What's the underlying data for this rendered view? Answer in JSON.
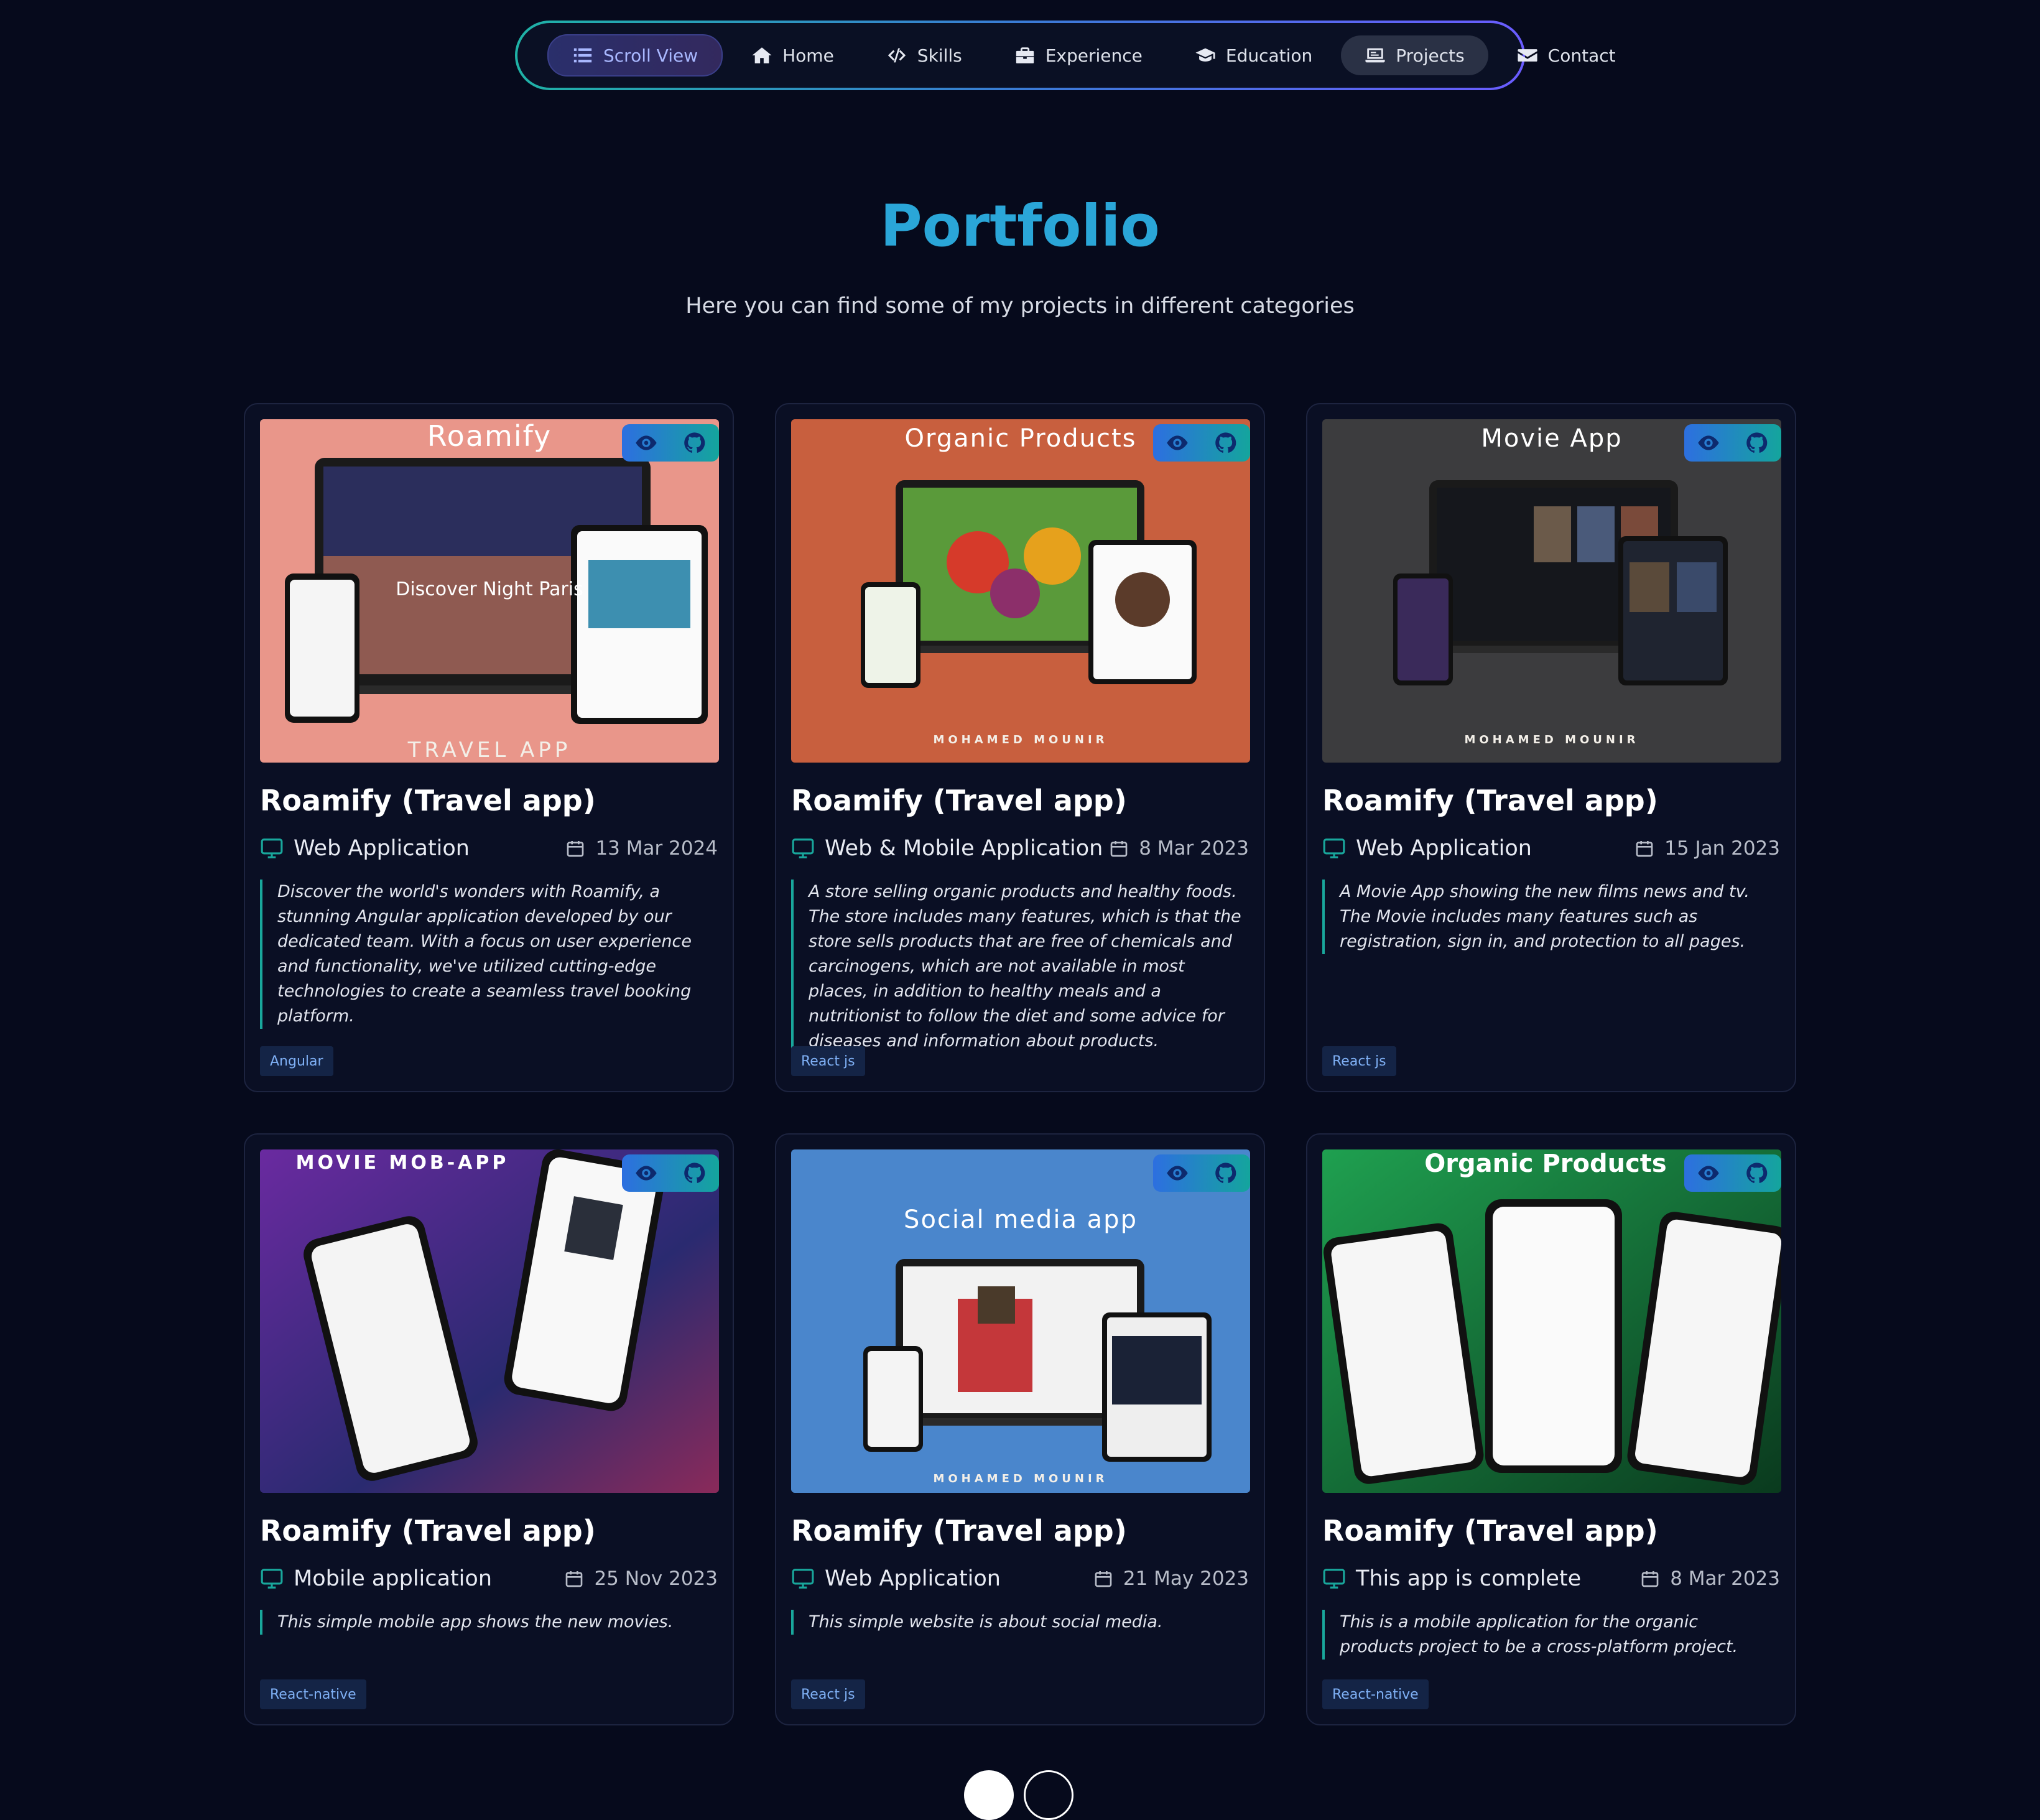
{
  "nav": {
    "items": [
      {
        "label": "Scroll View",
        "icon": "list-icon"
      },
      {
        "label": "Home",
        "icon": "home-icon"
      },
      {
        "label": "Skills",
        "icon": "code-icon"
      },
      {
        "label": "Experience",
        "icon": "briefcase-icon"
      },
      {
        "label": "Education",
        "icon": "graduation-cap-icon"
      },
      {
        "label": "Projects",
        "icon": "laptop-icon",
        "active": true
      },
      {
        "label": "Contact",
        "icon": "envelope-icon"
      }
    ]
  },
  "header": {
    "title": "Portfolio",
    "subtitle": "Here you can find some of my projects in different categories"
  },
  "projects": [
    {
      "thumb_caption": "Roamify",
      "thumb_footer": "TRAVEL APP",
      "thumb_tagline": "Discover Night Paris",
      "thumb_bg": "#e9968a",
      "title": "Roamify (Travel app)",
      "category": "Web Application",
      "date": "13 Mar 2024",
      "description": "Discover the world's wonders with Roamify, a stunning Angular application developed by our dedicated team. With a focus on user experience and functionality, we've utilized cutting-edge technologies to create a seamless travel booking platform.",
      "tag": "Angular"
    },
    {
      "thumb_caption": "Organic Products",
      "thumb_footer": "MOHAMED MOUNIR",
      "thumb_bg": "#c85f3e",
      "title": "Roamify (Travel app)",
      "category": "Web & Mobile Application",
      "date": "8 Mar 2023",
      "description": "A store selling organic products and healthy foods. The store includes many features, which is that the store sells products that are free of chemicals and carcinogens, which are not available in most places, in addition to healthy meals and a nutritionist to follow the diet and some advice for diseases and information about products.",
      "tag": "React js"
    },
    {
      "thumb_caption": "Movie App",
      "thumb_footer": "MOHAMED MOUNIR",
      "thumb_bg": "#3c3c3e",
      "title": "Roamify (Travel app)",
      "category": "Web Application",
      "date": "15 Jan 2023",
      "description": "A Movie App showing the new films news and tv. The Movie includes many features such as registration, sign in, and protection to all pages.",
      "tag": "React js"
    },
    {
      "thumb_caption": "MOVIE MOB-APP",
      "thumb_footer": "",
      "thumb_bg": "#5a2a8a",
      "title": "Roamify (Travel app)",
      "category": "Mobile application",
      "date": "25 Nov 2023",
      "description": "This simple mobile app shows the new movies.",
      "tag": "React-native"
    },
    {
      "thumb_caption": "Social media app",
      "thumb_footer": "MOHAMED MOUNIR",
      "thumb_bg": "#4a86cc",
      "title": "Roamify (Travel app)",
      "category": "Web Application",
      "date": "21 May 2023",
      "description": "This simple website is about social media.",
      "tag": "React js"
    },
    {
      "thumb_caption": "Organic Products",
      "thumb_footer": "",
      "thumb_bg": "#1c9a4a",
      "title": "Roamify (Travel app)",
      "category": "This app is complete",
      "date": "8 Mar 2023",
      "description": "This is a mobile application for the organic products project to be a cross-platform project.",
      "tag": "React-native"
    }
  ],
  "colors": {
    "background": "#060a1c",
    "accent": "#2aa6d8",
    "teal": "#19a79c",
    "card": "#0a0f24"
  },
  "pagination": {
    "pages": 2,
    "current": 1
  }
}
